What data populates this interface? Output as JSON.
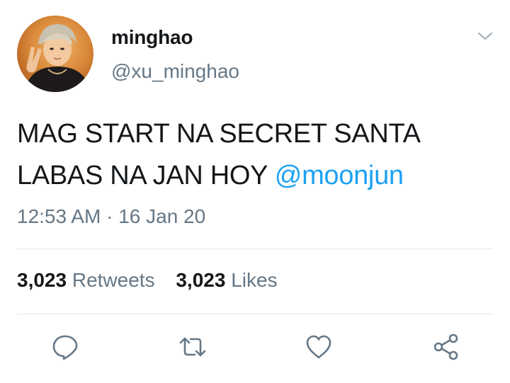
{
  "user": {
    "name": "minghao",
    "handle": "@xu_minghao"
  },
  "tweet": {
    "text_line1": "MAG START NA SECRET SANTA",
    "text_line2": "LABAS NA JAN HOY ",
    "mention": "@moonjun",
    "time": "12:53 AM",
    "separator": "·",
    "date": "16 Jan 20"
  },
  "stats": {
    "retweets_count": "3,023",
    "retweets_label": "Retweets",
    "likes_count": "3,023",
    "likes_label": "Likes"
  },
  "icons": {
    "menu": "chevron-down-icon",
    "reply": "reply-icon",
    "retweet": "retweet-icon",
    "like": "heart-icon",
    "share": "share-icon"
  },
  "colors": {
    "link": "#1da1f2",
    "secondary_text": "#657786",
    "primary_text": "#14171a",
    "divider": "#e1e8ed"
  }
}
